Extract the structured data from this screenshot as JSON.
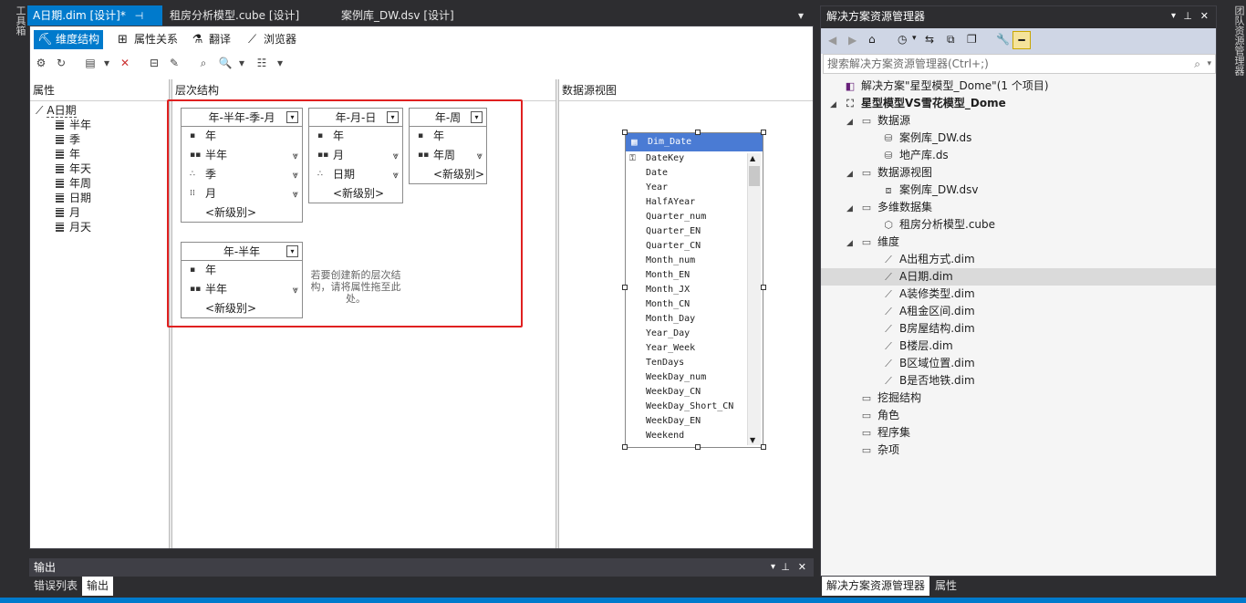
{
  "left_strip": {
    "label": "工具箱"
  },
  "right_strip": {
    "label": "团队资源管理器"
  },
  "doc_tabs": [
    {
      "label": "A日期.dim [设计]*"
    },
    {
      "label": "租房分析模型.cube [设计]"
    },
    {
      "label": "案例库_DW.dsv [设计]"
    }
  ],
  "designer": {
    "subtabs": [
      {
        "label": "维度结构"
      },
      {
        "label": "属性关系"
      },
      {
        "label": "翻译"
      },
      {
        "label": "浏览器"
      }
    ],
    "panes": {
      "attributes": "属性",
      "hierarchies": "层次结构",
      "dsv": "数据源视图"
    },
    "dimension": "A日期",
    "attributes": [
      "半年",
      "季",
      "年",
      "年天",
      "年周",
      "日期",
      "月",
      "月天"
    ],
    "hierarchies": [
      {
        "title": "年-半年-季-月",
        "levels": [
          "年",
          "半年",
          "季",
          "月"
        ]
      },
      {
        "title": "年-月-日",
        "levels": [
          "年",
          "月",
          "日期"
        ]
      },
      {
        "title": "年-周",
        "levels": [
          "年",
          "年周"
        ]
      },
      {
        "title": "年-半年",
        "levels": [
          "年",
          "半年"
        ]
      }
    ],
    "new_level": "<新级别>",
    "drop_hint": "若要创建新的层次结构，请将属性拖至此处。",
    "dsv_table": {
      "name": "Dim_Date",
      "columns": [
        "DateKey",
        "Date",
        "Year",
        "HalfAYear",
        "Quarter_num",
        "Quarter_EN",
        "Quarter_CN",
        "Month_num",
        "Month_EN",
        "Month_JX",
        "Month_CN",
        "Month_Day",
        "Year_Day",
        "Year_Week",
        "TenDays",
        "WeekDay_num",
        "WeekDay_CN",
        "WeekDay_Short_CN",
        "WeekDay_EN",
        "Weekend"
      ]
    }
  },
  "solution_explorer": {
    "title": "解决方案资源管理器",
    "search_placeholder": "搜索解决方案资源管理器(Ctrl+;)",
    "solution": "解决方案\"星型模型_Dome\"(1 个项目)",
    "project": "星型模型VS雪花模型_Dome",
    "folders": {
      "datasource": "数据源",
      "dsv": "数据源视图",
      "cubes": "多维数据集",
      "dims": "维度",
      "mining": "挖掘结构",
      "roles": "角色",
      "assemblies": "程序集",
      "misc": "杂项"
    },
    "datasources": [
      "案例库_DW.ds",
      "地产库.ds"
    ],
    "dsvs": [
      "案例库_DW.dsv"
    ],
    "cubes": [
      "租房分析模型.cube"
    ],
    "dimensions": [
      "A出租方式.dim",
      "A日期.dim",
      "A装修类型.dim",
      "A租金区间.dim",
      "B房屋结构.dim",
      "B楼层.dim",
      "B区域位置.dim",
      "B是否地铁.dim"
    ],
    "bottom_tabs": [
      "解决方案资源管理器",
      "属性"
    ]
  },
  "output": {
    "title": "输出",
    "tabs": [
      "错误列表",
      "输出"
    ]
  },
  "colors": {
    "accent": "#007acc",
    "highlight_box": "#e02020",
    "dsv_header": "#4a7bd4"
  }
}
